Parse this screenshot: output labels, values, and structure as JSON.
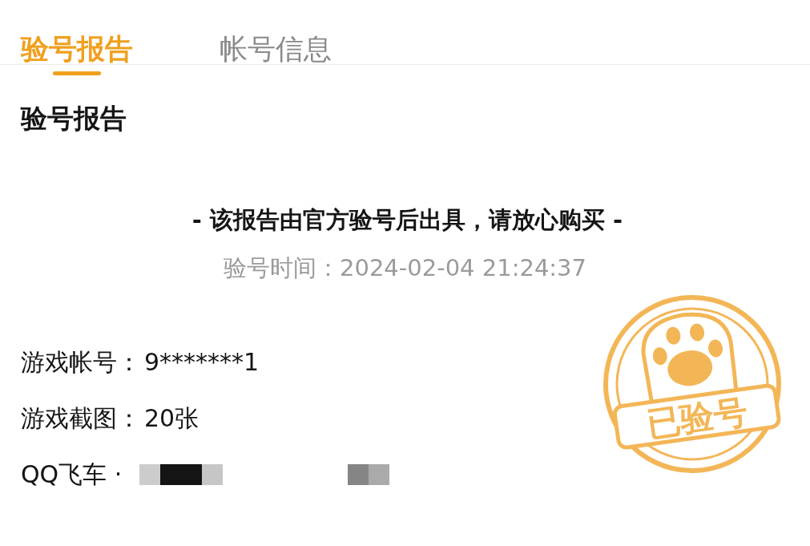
{
  "tabs": [
    {
      "label": "验号报告",
      "selected": true
    },
    {
      "label": "帐号信息",
      "selected": false
    }
  ],
  "section_title": "验号报告",
  "notice": "- 该报告由官方验号后出具，请放心购买 -",
  "check_time": "验号时间：2024-02-04 21:24:37",
  "fields": [
    {
      "kind": "text",
      "label": "游戏帐号：",
      "value": "9*******1"
    },
    {
      "kind": "text",
      "label": "游戏截图：",
      "value": "20张"
    },
    {
      "kind": "redacted",
      "label": "QQ飞车 ·"
    }
  ],
  "stamp": {
    "text": "已验号"
  }
}
